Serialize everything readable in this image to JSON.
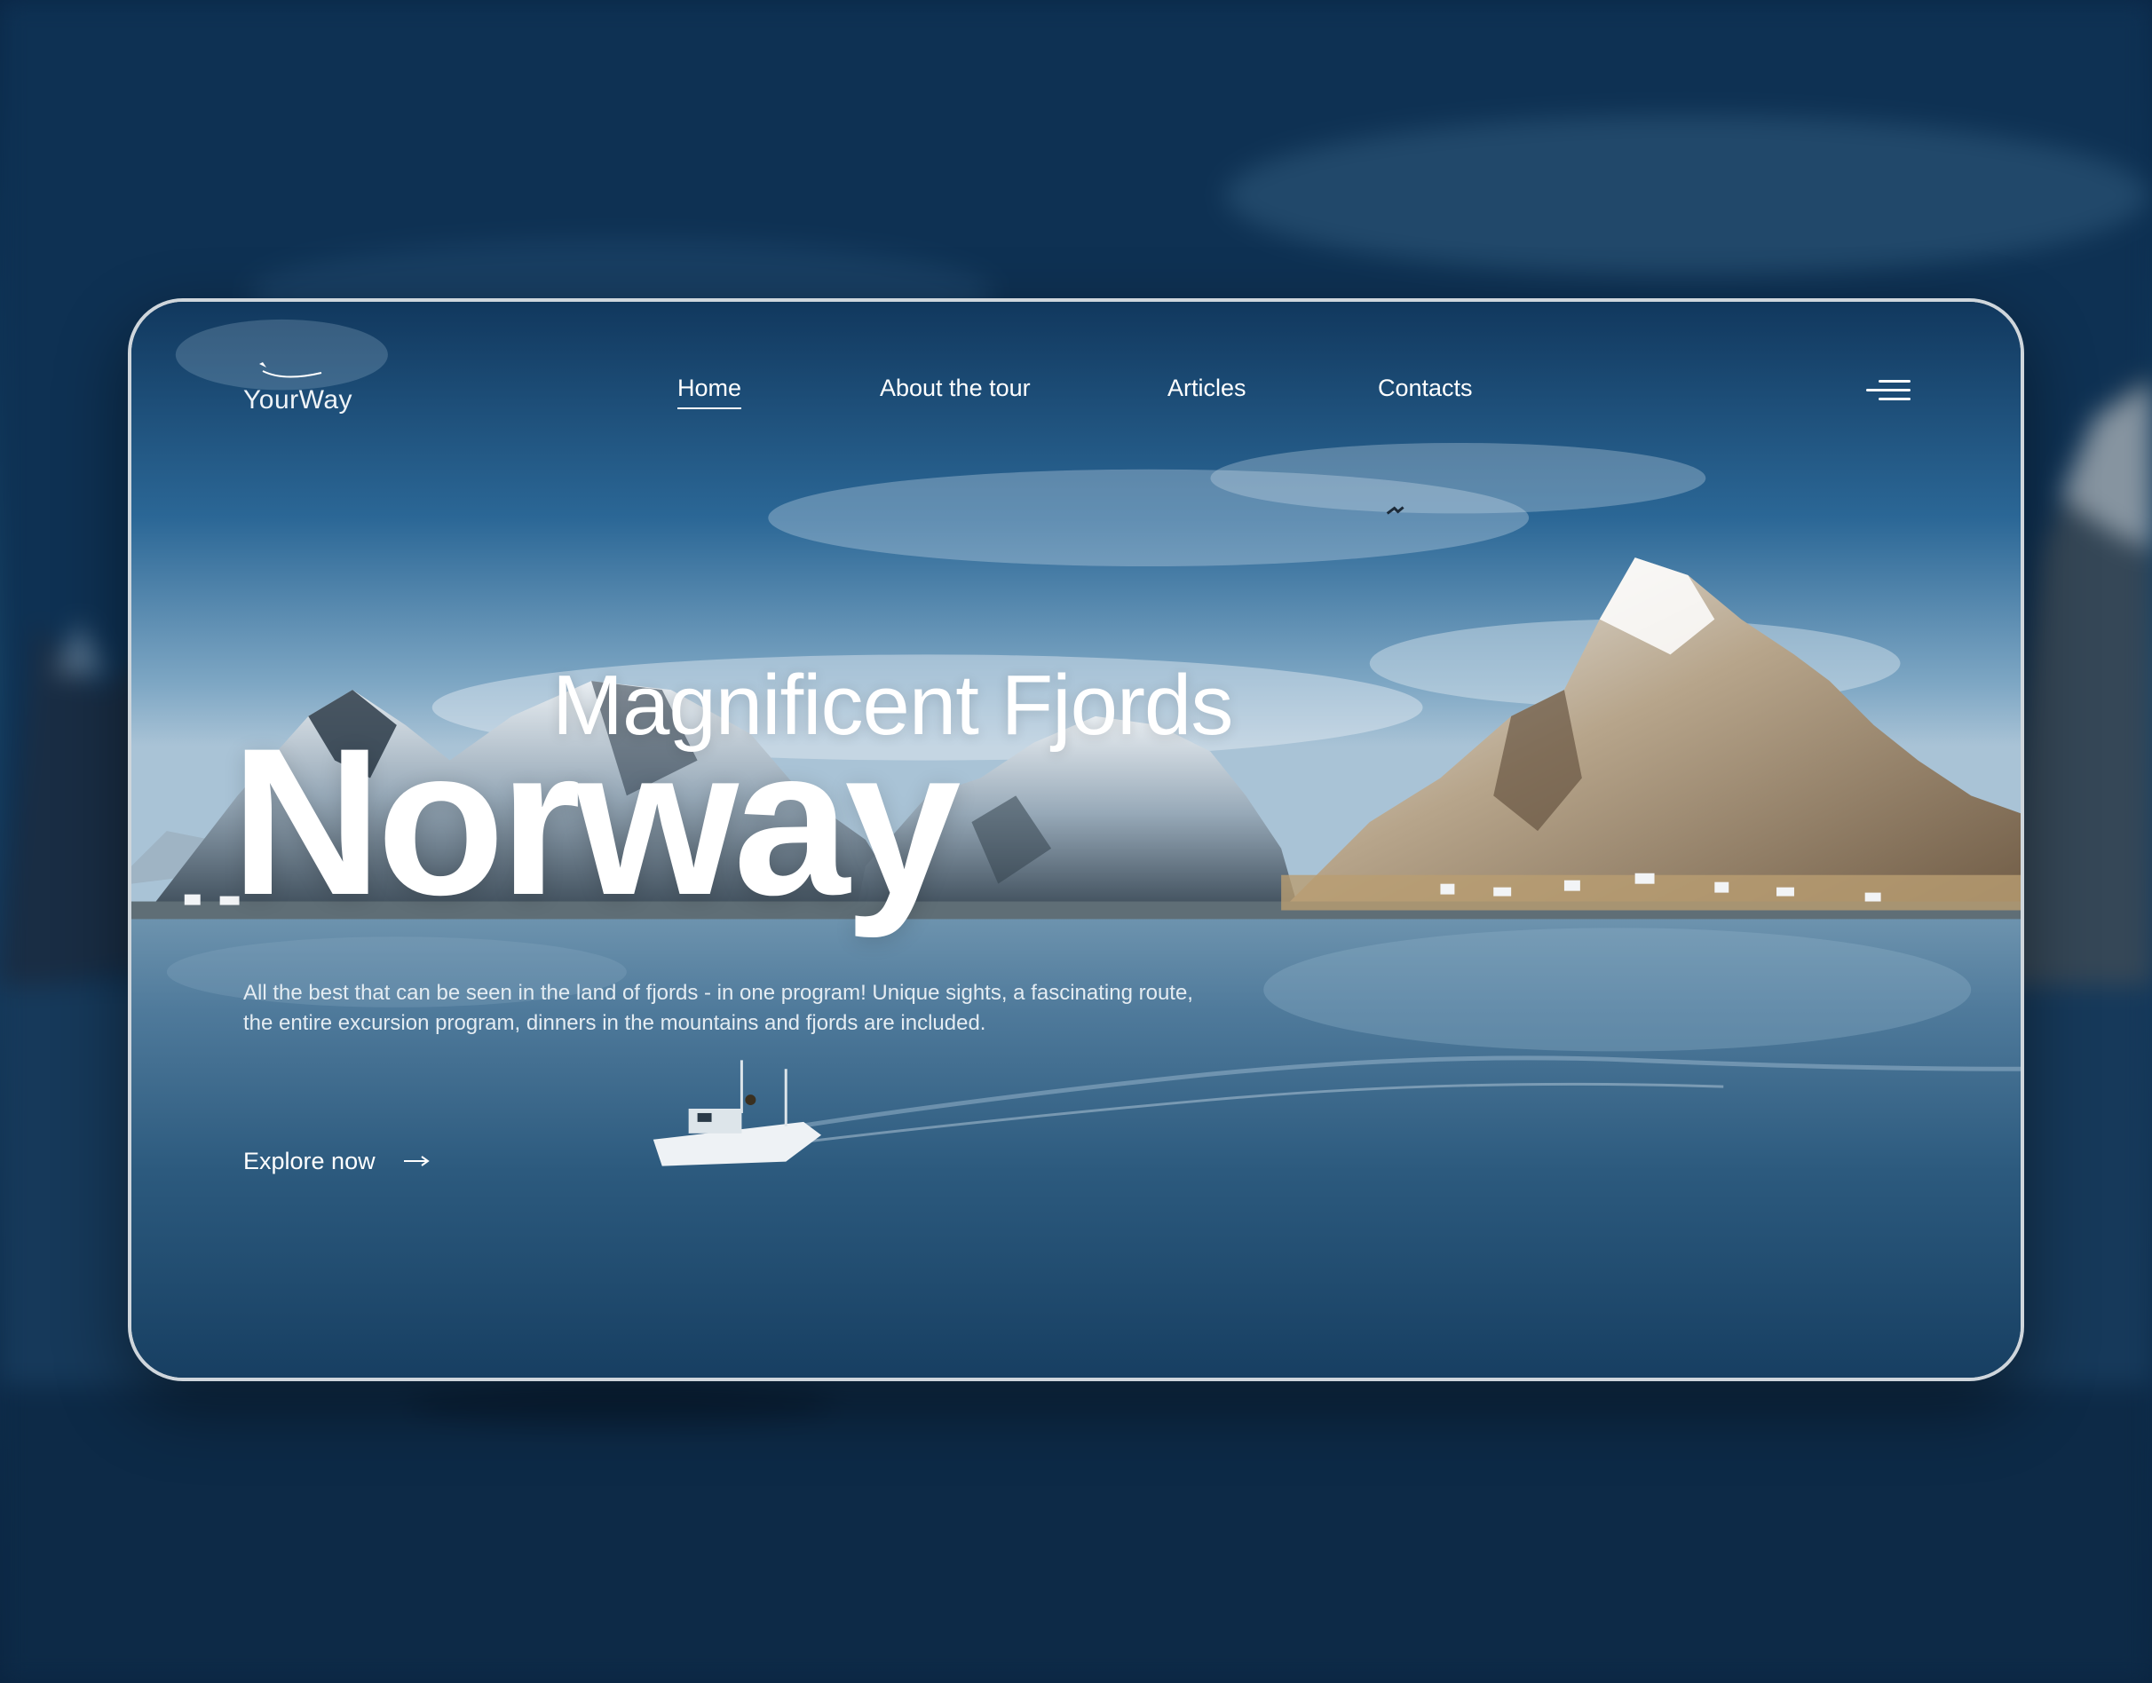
{
  "brand": {
    "name": "YourWay",
    "logo_icon": "airplane-swoosh-icon"
  },
  "nav": {
    "items": [
      {
        "label": "Home",
        "active": true
      },
      {
        "label": "About the tour",
        "active": false
      },
      {
        "label": "Articles",
        "active": false
      },
      {
        "label": "Contacts",
        "active": false
      }
    ],
    "menu_icon": "hamburger-menu-icon"
  },
  "hero": {
    "subtitle": "Magnificent Fjords",
    "title": "Norway",
    "description": "All the best that can be seen in the land of fjords - in one program! Unique sights, a fascinating route, the entire excursion program, dinners in the mountains and fjords are included.",
    "cta_label": "Explore now",
    "cta_icon": "arrow-right-icon"
  },
  "colors": {
    "text": "#ffffff",
    "card_border": "#cfd6dc",
    "backdrop": "#0b2846",
    "water": "#1f4f74",
    "sky": "#2d6a96"
  }
}
